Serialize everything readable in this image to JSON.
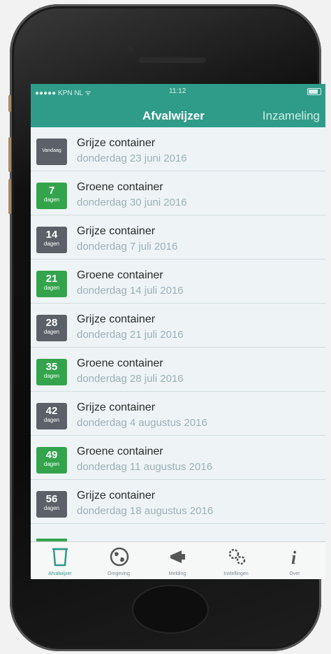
{
  "status_bar": {
    "carrier": "●●●●● KPN NL ᯤ",
    "time": "11:12"
  },
  "nav": {
    "title": "Afvalwijzer",
    "right": "Inzameling"
  },
  "items": [
    {
      "badge_text": "Vandaag",
      "color": "grey",
      "title": "Grijze container",
      "date": "donderdag 23 juni 2016"
    },
    {
      "badge_num": "7",
      "badge_unit": "dagen",
      "color": "green",
      "title": "Groene container",
      "date": "donderdag 30 juni 2016"
    },
    {
      "badge_num": "14",
      "badge_unit": "dagen",
      "color": "grey",
      "title": "Grijze container",
      "date": "donderdag 7 juli 2016"
    },
    {
      "badge_num": "21",
      "badge_unit": "dagen",
      "color": "green",
      "title": "Groene container",
      "date": "donderdag 14 juli 2016"
    },
    {
      "badge_num": "28",
      "badge_unit": "dagen",
      "color": "grey",
      "title": "Grijze container",
      "date": "donderdag 21 juli 2016"
    },
    {
      "badge_num": "35",
      "badge_unit": "dagen",
      "color": "green",
      "title": "Groene container",
      "date": "donderdag 28 juli 2016"
    },
    {
      "badge_num": "42",
      "badge_unit": "dagen",
      "color": "grey",
      "title": "Grijze container",
      "date": "donderdag 4 augustus 2016"
    },
    {
      "badge_num": "49",
      "badge_unit": "dagen",
      "color": "green",
      "title": "Groene container",
      "date": "donderdag 11 augustus 2016"
    },
    {
      "badge_num": "56",
      "badge_unit": "dagen",
      "color": "grey",
      "title": "Grijze container",
      "date": "donderdag 18 augustus 2016"
    }
  ],
  "tabs": [
    {
      "label": "Afvalwijzer",
      "icon": "trash-can-icon"
    },
    {
      "label": "Omgeving",
      "icon": "globe-icon"
    },
    {
      "label": "Melding",
      "icon": "megaphone-icon"
    },
    {
      "label": "Instellingen",
      "icon": "gears-icon"
    },
    {
      "label": "Over",
      "icon": "info-icon"
    }
  ],
  "colors": {
    "header": "#2f9b89",
    "green_badge": "#33a44c",
    "grey_badge": "#5b6167"
  }
}
